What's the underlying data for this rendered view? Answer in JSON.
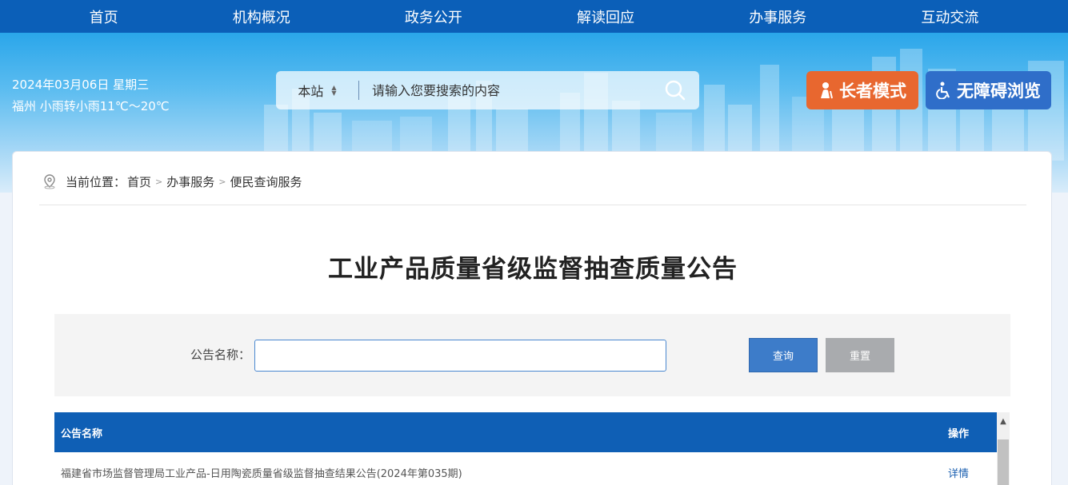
{
  "nav": {
    "items": [
      "首页",
      "机构概况",
      "政务公开",
      "解读回应",
      "办事服务",
      "互动交流"
    ]
  },
  "header": {
    "date": "2024年03月06日 星期三",
    "weather": "福州 小雨转小雨11℃～20℃",
    "search_scope": "本站",
    "search_placeholder": "请输入您要搜索的内容",
    "elder_mode_label": "长者模式",
    "accessible_label": "无障碍浏览"
  },
  "breadcrumb": {
    "prefix": "当前位置：",
    "items": [
      "首页",
      "办事服务",
      "便民查询服务"
    ],
    "separator": ">"
  },
  "page": {
    "title": "工业产品质量省级监督抽查质量公告"
  },
  "filter": {
    "label": "公告名称：",
    "input_value": "",
    "query_label": "查询",
    "reset_label": "重置"
  },
  "table": {
    "headers": [
      "公告名称",
      "操作"
    ],
    "rows": [
      {
        "name": "福建省市场监督管理局工业产品-日用陶瓷质量省级监督抽查结果公告(2024年第035期)",
        "action": "详情"
      }
    ]
  },
  "colors": {
    "nav_bg": "#0b5fb8",
    "elder_btn": "#e8672f",
    "accessible_btn": "#2f6ec9",
    "table_head": "#0f5fb5",
    "query_btn": "#3d7cc9",
    "reset_btn": "#a9abae"
  }
}
